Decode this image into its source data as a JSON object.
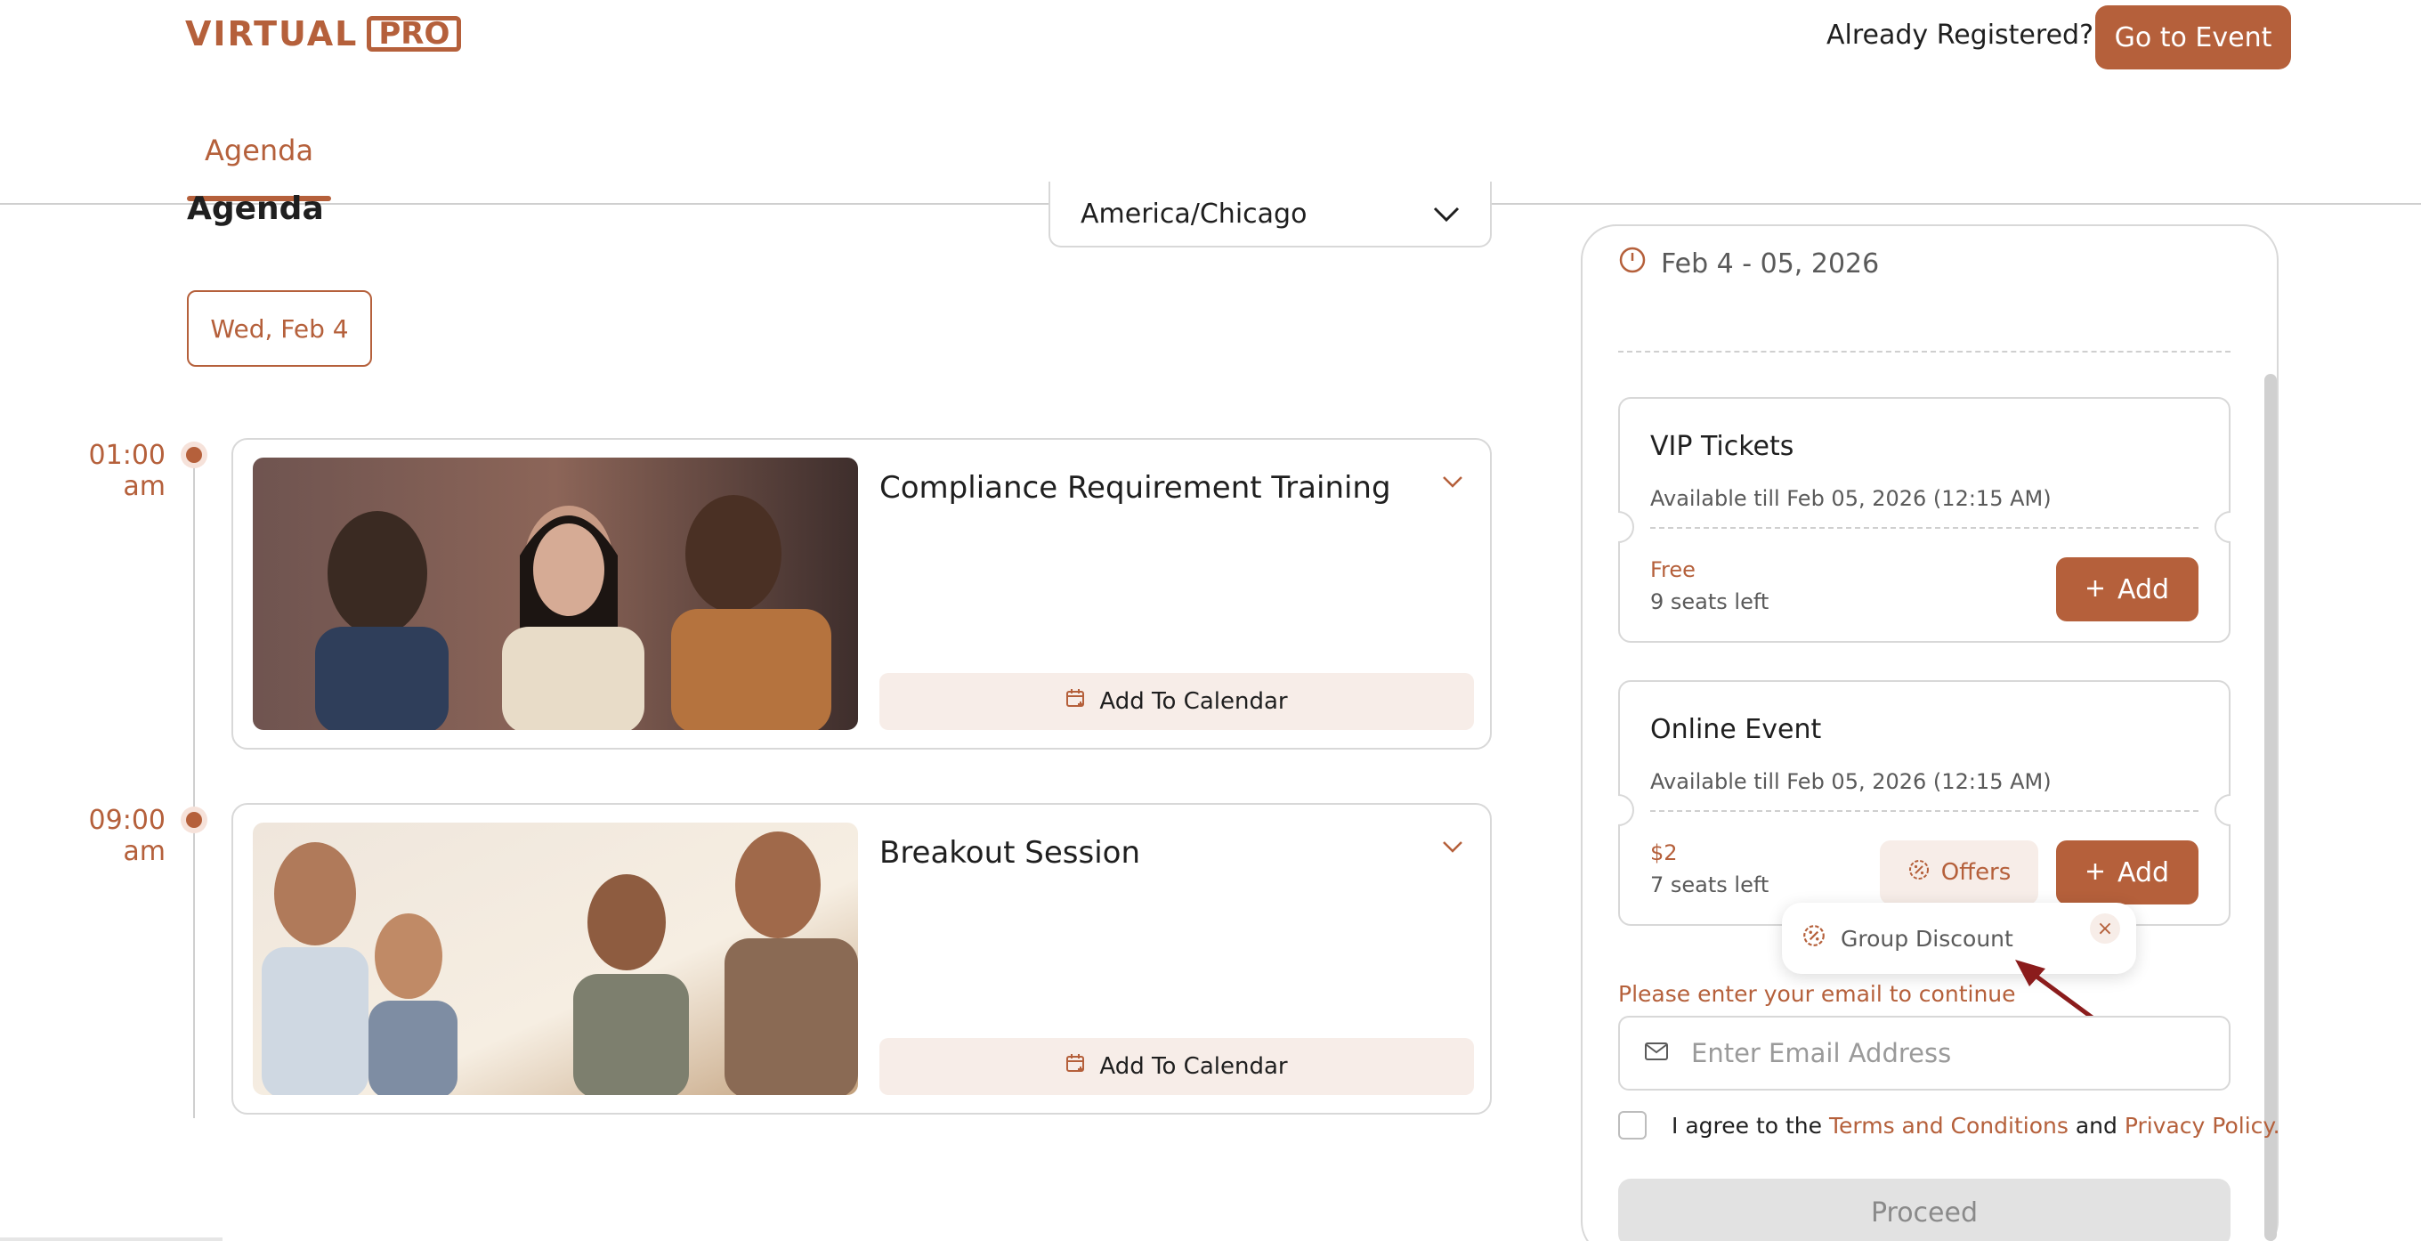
{
  "brand": {
    "name": "VIRTUAL",
    "suffix": "PRO",
    "accent": "#b5603b",
    "accent_light": "#f7ede8"
  },
  "header": {
    "already_registered": "Already Registered?",
    "go_to_event": "Go to Event"
  },
  "tabs": [
    {
      "label": "Agenda",
      "active": true
    }
  ],
  "agenda": {
    "heading": "Agenda",
    "timezone": "America/Chicago",
    "date_chip": "Wed, Feb 4",
    "sessions": [
      {
        "time": "01:00 am",
        "title": "Compliance Requirement Training",
        "calendar_label": "Add To Calendar",
        "photo": "group-portrait-photo"
      },
      {
        "time": "09:00 am",
        "title": "Breakout Session",
        "calendar_label": "Add To Calendar",
        "photo": "friends-sunset-photo"
      }
    ]
  },
  "event": {
    "date_range": "Feb 4 - 05, 2026",
    "tickets": [
      {
        "name": "VIP Tickets",
        "availability": "Available till Feb 05, 2026 (12:15 AM)",
        "price": "Free",
        "seats": "9 seats left",
        "add_label": "Add"
      },
      {
        "name": "Online Event",
        "availability": "Available till Feb 05, 2026 (12:15 AM)",
        "price": "$2",
        "seats": "7 seats left",
        "add_label": "Add",
        "offers_label": "Offers"
      }
    ],
    "offers_popover": {
      "item": "Group Discount",
      "close": "×"
    },
    "email_prompt": "Please enter your email to continue",
    "email_placeholder": "Enter Email Address",
    "agree": {
      "prefix": "I agree to the",
      "terms": "Terms and Conditions",
      "and": "and",
      "privacy": "Privacy Policy",
      "suffix": "."
    },
    "proceed": "Proceed"
  }
}
